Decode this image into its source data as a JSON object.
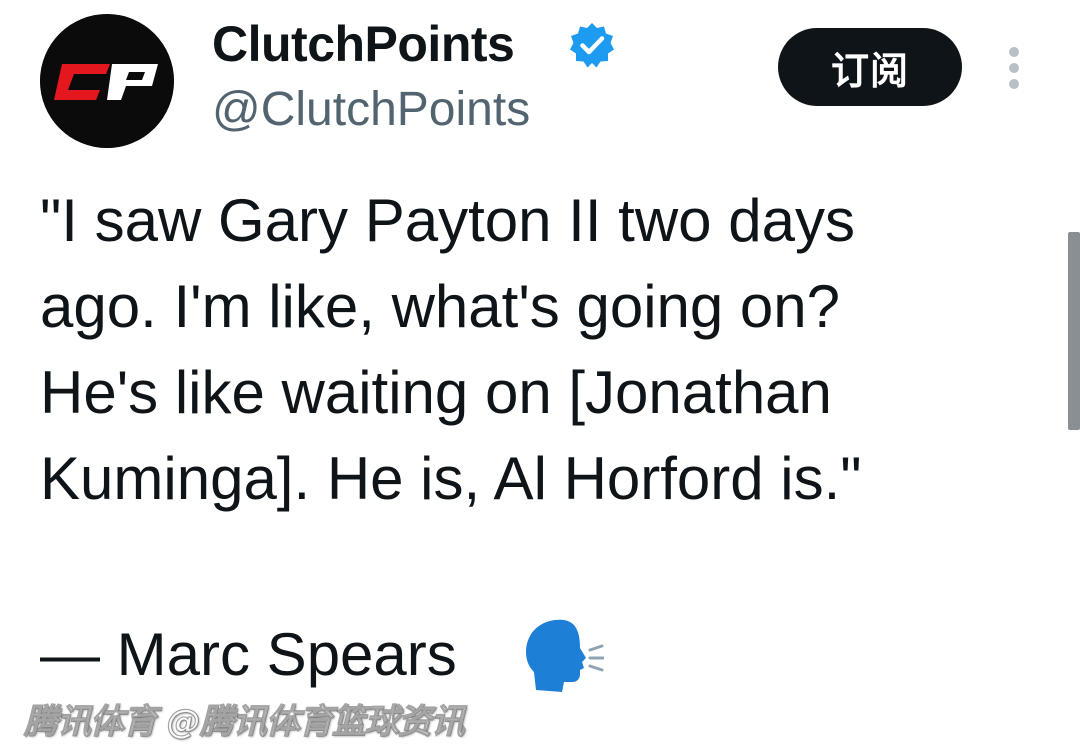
{
  "account": {
    "display_name": "ClutchPoints",
    "handle": "@ClutchPoints",
    "verified": true,
    "avatar_logo_text": "CP"
  },
  "actions": {
    "subscribe_label": "订阅",
    "more_icon": "vertical-ellipsis-icon"
  },
  "tweet": {
    "lines": [
      "\"I saw Gary Payton II two days",
      "ago. I'm like, what's going on?",
      "He's like waiting on [Jonathan",
      "Kuminga]. He is, Al Horford is.\""
    ],
    "attribution": "— Marc Spears",
    "attribution_emoji": "speaking-head-icon"
  },
  "watermark": "腾讯体育 @腾讯体育篮球资讯",
  "colors": {
    "text": "#0f1419",
    "secondary_text": "#536471",
    "verified_blue": "#1d9bf0",
    "button_bg": "#0f1419",
    "logo_red": "#e4161e",
    "emoji_blue": "#1e7fd6"
  }
}
